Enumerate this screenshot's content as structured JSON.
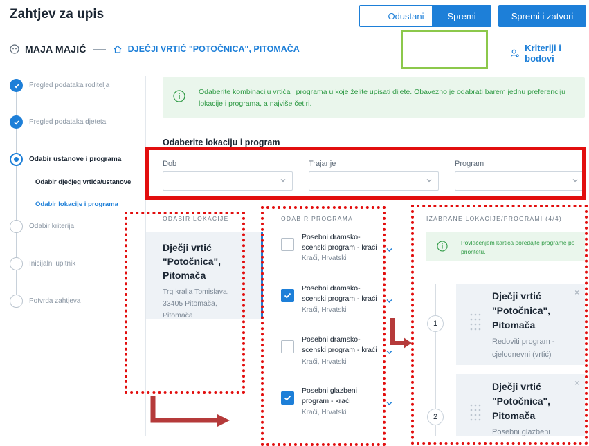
{
  "header": {
    "title": "Zahtjev za upis",
    "cancel_label": "Odustani",
    "save_label": "Spremi",
    "save_close_label": "Spremi i zatvori"
  },
  "breadcrumb": {
    "user_name": "MAJA MAJIĆ",
    "kindergarten": "DJEČJI VRTIĆ \"POTOČNICA\", PITOMAČA",
    "criteria_link": "Kriteriji i bodovi"
  },
  "steps": [
    {
      "label": "Pregled podataka roditelja",
      "state": "done"
    },
    {
      "label": "Pregled podataka djeteta",
      "state": "done"
    },
    {
      "label": "Odabir ustanove i programa",
      "state": "active"
    },
    {
      "label": "Odabir kriterija",
      "state": "pending"
    },
    {
      "label": "Inicijalni upitnik",
      "state": "pending"
    },
    {
      "label": "Potvrda zahtjeva",
      "state": "pending"
    }
  ],
  "substeps": [
    {
      "label": "Odabir dječjeg vrtića/ustanove",
      "state": "done"
    },
    {
      "label": "Odabir lokacije i programa",
      "state": "active"
    }
  ],
  "info": {
    "text": "Odaberite kombinaciju vrtića i programa u koje želite upisati dijete. Obavezno je odabrati barem jednu preferenciju lokacije i programa, a najviše četiri."
  },
  "filters": {
    "section_title": "Odaberite lokaciju i program",
    "dob_label": "Dob",
    "trajanje_label": "Trajanje",
    "program_label": "Program"
  },
  "locations": {
    "header": "ODABIR LOKACIJE",
    "items": [
      {
        "name": "Dječji vrtić \"Potočnica\", Pitomača",
        "address": "Trg kralja Tomislava, 33405 Pitomača, Pitomača"
      }
    ]
  },
  "programs": {
    "header": "ODABIR PROGRAMA",
    "items": [
      {
        "title": "Posebni dramsko-scenski program - kraći",
        "sub": "Kraći, Hrvatski",
        "checked": false
      },
      {
        "title": "Posebni dramsko-scenski program - kraći",
        "sub": "Kraći, Hrvatski",
        "checked": true
      },
      {
        "title": "Posebni dramsko-scenski program - kraći",
        "sub": "Kraći, Hrvatski",
        "checked": false
      },
      {
        "title": "Posebni glazbeni program - kraći",
        "sub": "Kraći, Hrvatski",
        "checked": true
      }
    ]
  },
  "selected": {
    "header": "IZABRANE LOKACIJE/PROGRAMI (4/4)",
    "hint": "Povlačenjem kartica poredajte programe po prioritetu.",
    "items": [
      {
        "number": "1",
        "name": "Dječji vrtić \"Potočnica\", Pitomača",
        "program": "Redoviti program - cjelodnevni (vrtić)"
      },
      {
        "number": "2",
        "name": "Dječji vrtić \"Potočnica\", Pitomača",
        "program": "Posebni glazbeni"
      }
    ],
    "close_label": "×"
  },
  "colors": {
    "accent": "#1d7fd8",
    "success_bg": "#eaf6ec",
    "success_text": "#2f9a45",
    "annotation_red": "#e20e0e",
    "annotation_green": "#8cc84b",
    "arrow": "#b53a3a"
  },
  "icons": [
    "user-icon",
    "home-icon",
    "person-settings-icon",
    "info-icon",
    "check-icon",
    "chevron-down-icon",
    "drag-handle-icon",
    "close-icon",
    "arrow-icon"
  ]
}
